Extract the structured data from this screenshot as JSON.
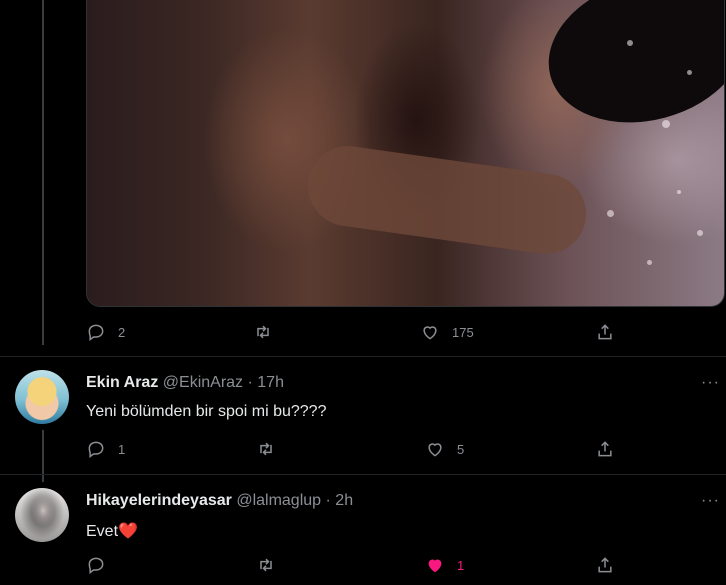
{
  "tweet_main": {
    "reply_count": "2",
    "like_count": "175"
  },
  "replies": [
    {
      "display_name": "Ekin Araz",
      "handle": "@EkinAraz",
      "dot": "·",
      "time": "17h",
      "text": "Yeni bölümden bir spoi mi bu????",
      "reply_count": "1",
      "like_count": "5",
      "liked": false,
      "more": "···"
    },
    {
      "display_name": "Hikayelerindeyasar",
      "handle": "@lalmaglup",
      "dot": "·",
      "time": "2h",
      "text": "Evet",
      "emoji": "❤️",
      "like_count": "1",
      "liked": true,
      "more": "···"
    }
  ],
  "colors": {
    "like_active": "#f91880",
    "icon_muted": "#8b8f94",
    "heart_emoji": "#e0245e"
  }
}
